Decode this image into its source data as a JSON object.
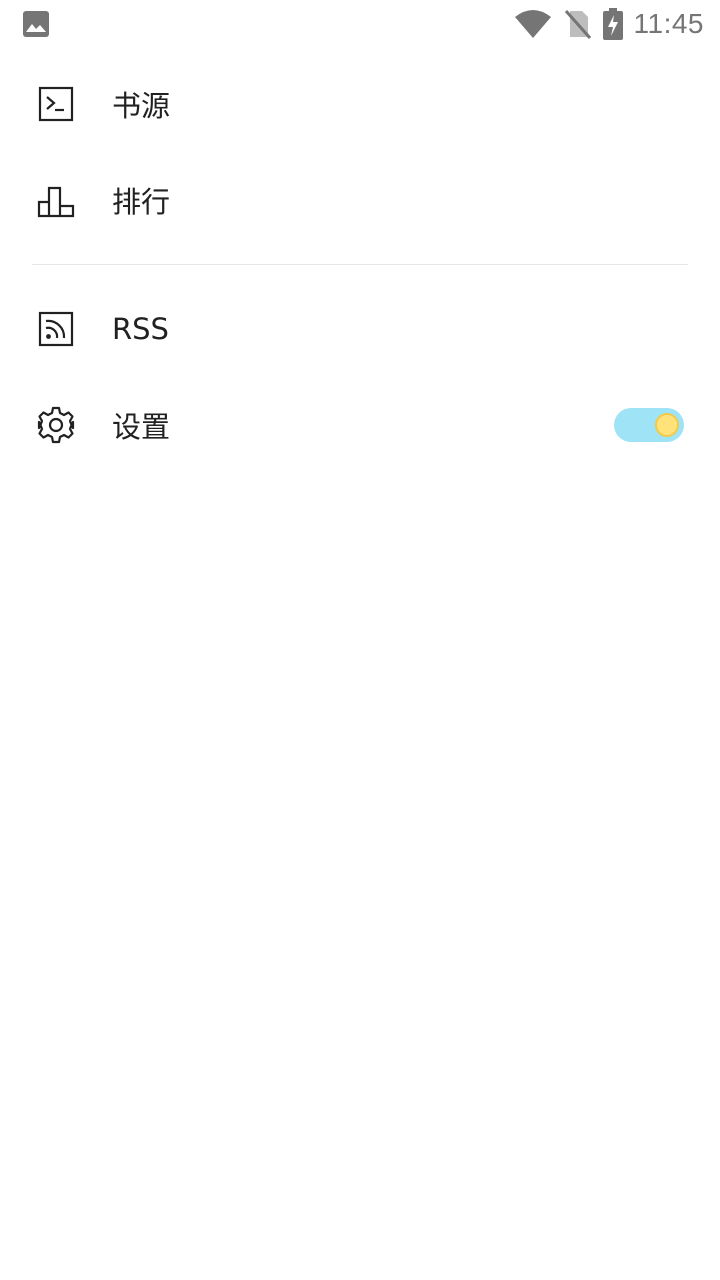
{
  "status_bar": {
    "time": "11:45",
    "icons": [
      "image-icon",
      "wifi-icon",
      "no-sim-icon",
      "battery-charging-icon"
    ]
  },
  "menu": {
    "items": [
      {
        "label": "书源",
        "icon": "terminal-icon"
      },
      {
        "label": "排行",
        "icon": "bar-chart-icon"
      },
      {
        "label": "RSS",
        "icon": "rss-icon"
      },
      {
        "label": "设置",
        "icon": "gear-icon"
      }
    ],
    "theme_toggle": {
      "on": true
    }
  },
  "colors": {
    "text": "#212121",
    "status_icons": "#757575",
    "divider": "#e6e6e6",
    "toggle_track": "#9fe3f7",
    "toggle_knob": "#ffe27a"
  }
}
